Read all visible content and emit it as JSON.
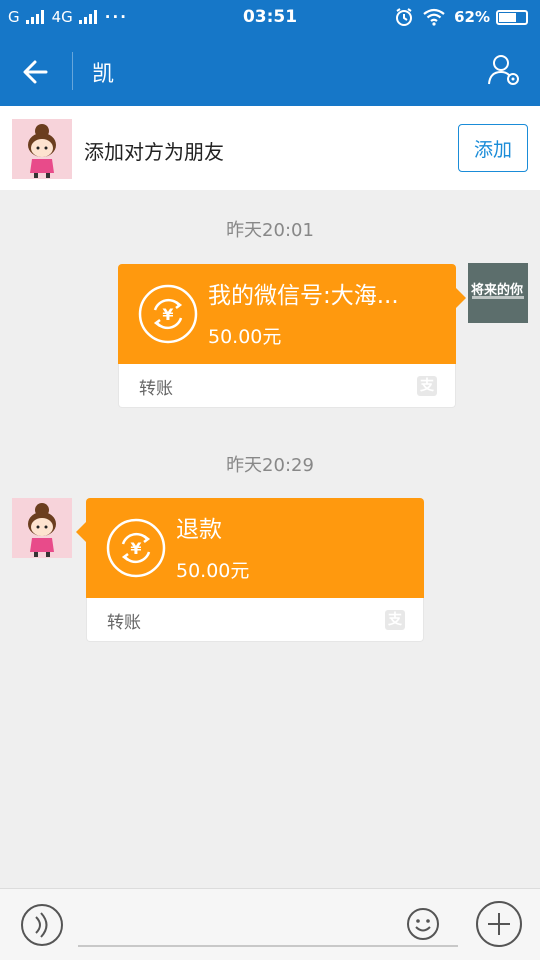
{
  "status_bar": {
    "carrier_1": "G",
    "carrier_2": "4G",
    "more": "···",
    "time": "03:51",
    "battery": "62%"
  },
  "nav": {
    "title": "凯"
  },
  "add_friend": {
    "text": "添加对方为朋友",
    "button": "添加"
  },
  "messages": [
    {
      "timestamp": "昨天20:01",
      "direction": "sent",
      "title": "我的微信号:大海...",
      "amount": "50.00元",
      "label": "转账",
      "avatar_text": "将来的你"
    },
    {
      "timestamp": "昨天20:29",
      "direction": "received",
      "title": "退款",
      "amount": "50.00元",
      "label": "转账"
    }
  ],
  "colors": {
    "primary": "#1677c8",
    "transfer": "#ff990e",
    "background": "#efefef"
  },
  "icons": {
    "back": "arrow-left-icon",
    "profile": "profile-settings-icon",
    "transfer": "yuan-exchange-icon",
    "alipay": "alipay-icon",
    "voice": "voice-icon",
    "emoji": "emoji-icon",
    "plus": "plus-icon"
  }
}
